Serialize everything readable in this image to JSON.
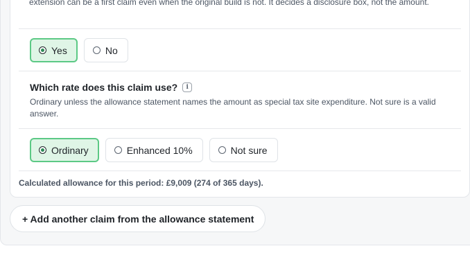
{
  "first_claim_question": {
    "help_text_fragment": "extension can be a first claim even when the original build is not. It decides a disclosure box, not the amount.",
    "options": [
      {
        "label": "Yes",
        "selected": true
      },
      {
        "label": "No",
        "selected": false
      }
    ]
  },
  "rate_question": {
    "title": "Which rate does this claim use?",
    "info_icon_glyph": "i",
    "help_text": "Ordinary unless the allowance statement names the amount as special tax site expenditure. Not sure is a valid answer.",
    "options": [
      {
        "label": "Ordinary",
        "selected": true
      },
      {
        "label": "Enhanced 10%",
        "selected": false
      },
      {
        "label": "Not sure",
        "selected": false
      }
    ]
  },
  "calculated_allowance": "Calculated allowance for this period: £9,009 (274 of 365 days).",
  "add_claim_button": "+ Add another claim from the allowance statement",
  "colors": {
    "selected_fill": "#dff5e6",
    "selected_border": "#5cc985",
    "selected_dot": "#2e8b57"
  }
}
